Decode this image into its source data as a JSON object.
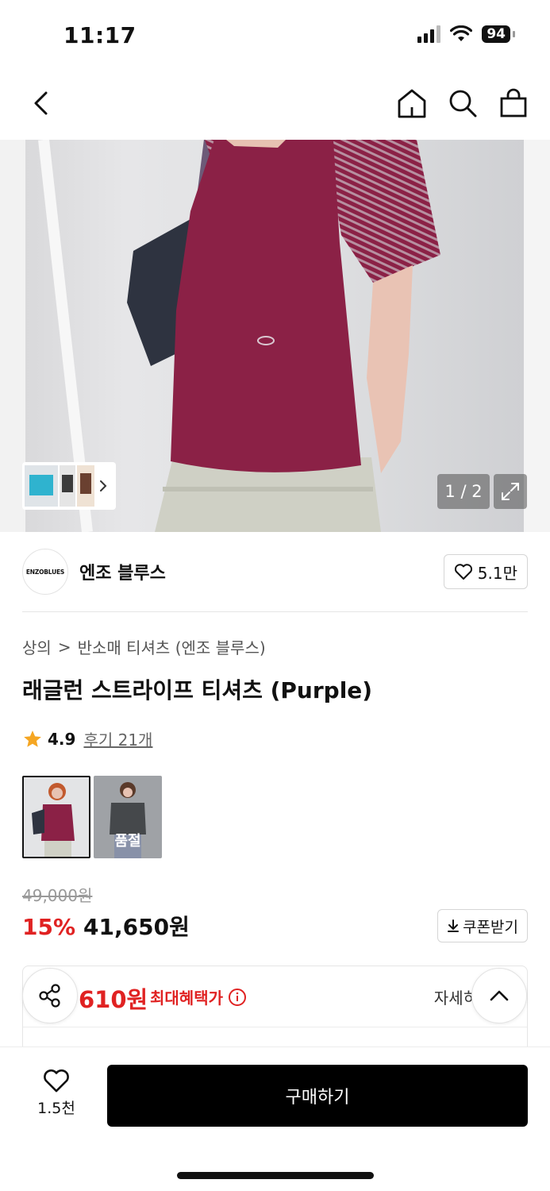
{
  "status": {
    "time": "11:17",
    "battery": "94"
  },
  "nav": {
    "back_icon": "chevron-left-icon",
    "icons": [
      "home-icon",
      "search-icon",
      "shopping-bag-icon"
    ]
  },
  "gallery": {
    "counter": "1 / 2"
  },
  "brand": {
    "logo_text": "ENZOBLUES",
    "name": "엔조 블루스",
    "likes": "5.1만"
  },
  "breadcrumb": {
    "category": "상의",
    "sep": ">",
    "subcategory": "반소매 티셔츠 (엔조 블루스)"
  },
  "product": {
    "title": "래글런 스트라이프 티셔츠 (Purple)",
    "rating": "4.9",
    "reviews": "후기 21개",
    "soldout_label": "품절",
    "original_price": "49,000원",
    "discount": "15%",
    "sale_price": "41,650원",
    "coupon_label": "쿠폰받기"
  },
  "benefit": {
    "price": "610원",
    "label": "최대혜택가",
    "detail": "자세히"
  },
  "bottom": {
    "wish_count": "1.5천",
    "buy_label": "구매하기"
  },
  "colors": {
    "accent_red": "#e02222",
    "shirt": "#8b2146",
    "dark": "#111111"
  }
}
